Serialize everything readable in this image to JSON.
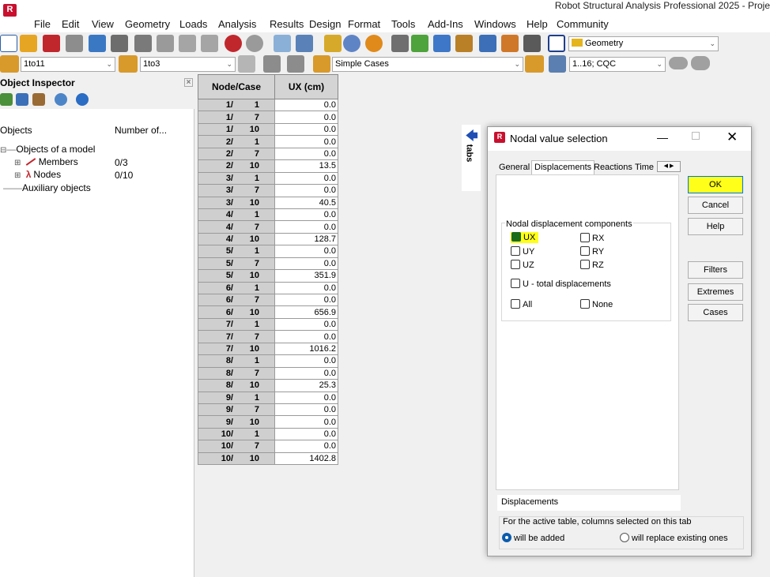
{
  "app": {
    "title": "Robot Structural Analysis Professional 2025 - Proje",
    "logo": "R"
  },
  "menu": [
    "File",
    "Edit",
    "View",
    "Geometry",
    "Loads",
    "Analysis",
    "Results",
    "Design",
    "Format",
    "Tools",
    "Add-Ins",
    "Windows",
    "Help",
    "Community"
  ],
  "toolbar": {
    "layout_combo": "Geometry",
    "nodes_combo": "1to11",
    "cases_combo": "1to3",
    "case_type_combo": "Simple Cases",
    "combination_combo": "1..16; CQC"
  },
  "inspector": {
    "title": "Object Inspector",
    "col_objects": "Objects",
    "col_number": "Number of...",
    "tree": {
      "root": "Objects of a model",
      "members": "Members",
      "members_count": "0/3",
      "nodes": "Nodes",
      "nodes_count": "0/10",
      "aux": "Auxiliary objects"
    }
  },
  "table": {
    "col_nodecase": "Node/Case",
    "col_ux": "UX (cm)",
    "rows": [
      {
        "node": "1/",
        "case": "1",
        "ux": "0.0"
      },
      {
        "node": "1/",
        "case": "7",
        "ux": "0.0"
      },
      {
        "node": "1/",
        "case": "10",
        "ux": "0.0"
      },
      {
        "node": "2/",
        "case": "1",
        "ux": "0.0"
      },
      {
        "node": "2/",
        "case": "7",
        "ux": "0.0"
      },
      {
        "node": "2/",
        "case": "10",
        "ux": "13.5"
      },
      {
        "node": "3/",
        "case": "1",
        "ux": "0.0"
      },
      {
        "node": "3/",
        "case": "7",
        "ux": "0.0"
      },
      {
        "node": "3/",
        "case": "10",
        "ux": "40.5"
      },
      {
        "node": "4/",
        "case": "1",
        "ux": "0.0"
      },
      {
        "node": "4/",
        "case": "7",
        "ux": "0.0"
      },
      {
        "node": "4/",
        "case": "10",
        "ux": "128.7"
      },
      {
        "node": "5/",
        "case": "1",
        "ux": "0.0"
      },
      {
        "node": "5/",
        "case": "7",
        "ux": "0.0"
      },
      {
        "node": "5/",
        "case": "10",
        "ux": "351.9"
      },
      {
        "node": "6/",
        "case": "1",
        "ux": "0.0"
      },
      {
        "node": "6/",
        "case": "7",
        "ux": "0.0"
      },
      {
        "node": "6/",
        "case": "10",
        "ux": "656.9"
      },
      {
        "node": "7/",
        "case": "1",
        "ux": "0.0"
      },
      {
        "node": "7/",
        "case": "7",
        "ux": "0.0"
      },
      {
        "node": "7/",
        "case": "10",
        "ux": "1016.2"
      },
      {
        "node": "8/",
        "case": "1",
        "ux": "0.0"
      },
      {
        "node": "8/",
        "case": "7",
        "ux": "0.0"
      },
      {
        "node": "8/",
        "case": "10",
        "ux": "25.3"
      },
      {
        "node": "9/",
        "case": "1",
        "ux": "0.0"
      },
      {
        "node": "9/",
        "case": "7",
        "ux": "0.0"
      },
      {
        "node": "9/",
        "case": "10",
        "ux": "0.0"
      },
      {
        "node": "10/",
        "case": "1",
        "ux": "0.0"
      },
      {
        "node": "10/",
        "case": "7",
        "ux": "0.0"
      },
      {
        "node": "10/",
        "case": "10",
        "ux": "1402.8"
      }
    ]
  },
  "side_tab": "tabs",
  "dialog": {
    "title": "Nodal value selection",
    "tabs": [
      "General",
      "Displacements",
      "Reactions",
      "Time"
    ],
    "active_tab": "Displacements",
    "group_label": "Nodal displacement components",
    "checks": {
      "ux": "UX",
      "rx": "RX",
      "uy": "UY",
      "ry": "RY",
      "uz": "UZ",
      "rz": "RZ",
      "u_total": "U - total displacements",
      "all": "All",
      "none": "None"
    },
    "checked": [
      "UX"
    ],
    "buttons": {
      "ok": "OK",
      "cancel": "Cancel",
      "help": "Help",
      "filters": "Filters",
      "extremes": "Extremes",
      "cases": "Cases"
    },
    "status_label": "Displacements",
    "columns_note": "For the active table, columns selected on this tab",
    "radio_add": "will be added",
    "radio_replace": "will replace existing ones",
    "radio_selected": "will be added",
    "highlight_color": "#ffff1a"
  }
}
